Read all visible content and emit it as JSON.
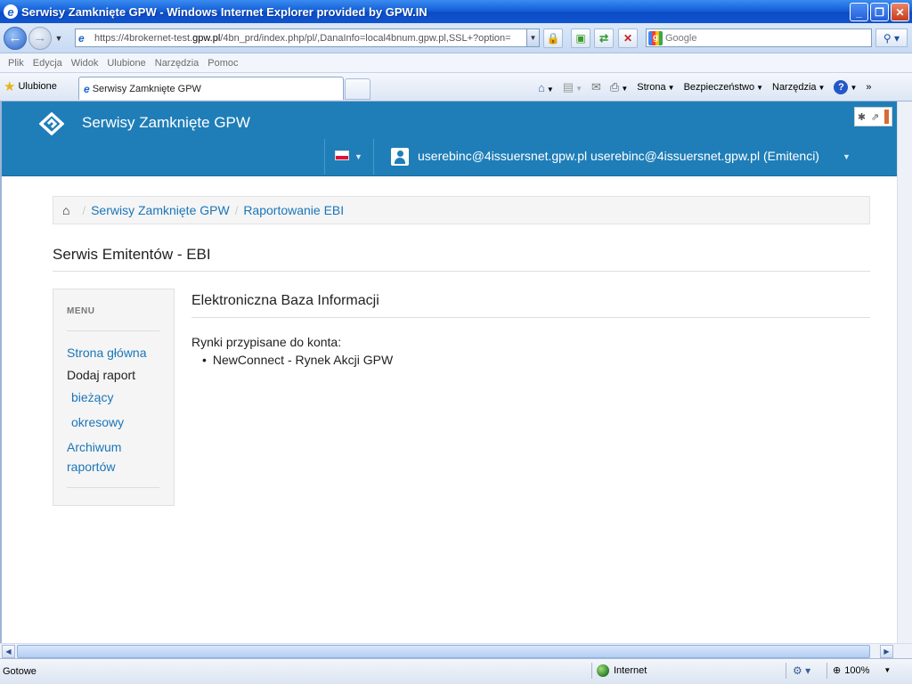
{
  "window": {
    "title": "Serwisy Zamknięte GPW - Windows Internet Explorer provided by GPW.IN",
    "minimize": "_",
    "restore": "❐",
    "close": "✕"
  },
  "address": {
    "scheme": "https://",
    "host_prefix": "4brokernet-test.",
    "host_main": "gpw.pl",
    "path": "/4bn_prd/index.php/pl/,DanaInfo=local4bnum.gpw.pl,SSL+?option=",
    "search_placeholder": "Google"
  },
  "menu": [
    "Plik",
    "Edycja",
    "Widok",
    "Ulubione",
    "Narzędzia",
    "Pomoc"
  ],
  "favorites_label": "Ulubione",
  "tab_title": "Serwisy Zamknięte GPW",
  "commands": {
    "page": "Strona",
    "safety": "Bezpieczeństwo",
    "tools": "Narzędzia"
  },
  "site": {
    "brand": "Serwisy Zamknięte GPW",
    "user": "userebinc@4issuersnet.gpw.pl userebinc@4issuersnet.gpw.pl (Emitenci)",
    "breadcrumb": [
      "Serwisy Zamknięte GPW",
      "Raportowanie EBI"
    ],
    "page_title": "Serwis Emitentów - EBI",
    "sidebar": {
      "title": "MENU",
      "home": "Strona główna",
      "add_report": "Dodaj raport",
      "current": "bieżący",
      "periodic": "okresowy",
      "archive_line1": "Archiwum",
      "archive_line2": "raportów"
    },
    "content": {
      "heading": "Elektroniczna Baza Informacji",
      "markets_label": "Rynki przypisane do konta:",
      "markets": [
        "NewConnect - Rynek Akcji GPW"
      ]
    }
  },
  "status": {
    "text": "Gotowe",
    "zone": "Internet",
    "zoom": "100%"
  }
}
